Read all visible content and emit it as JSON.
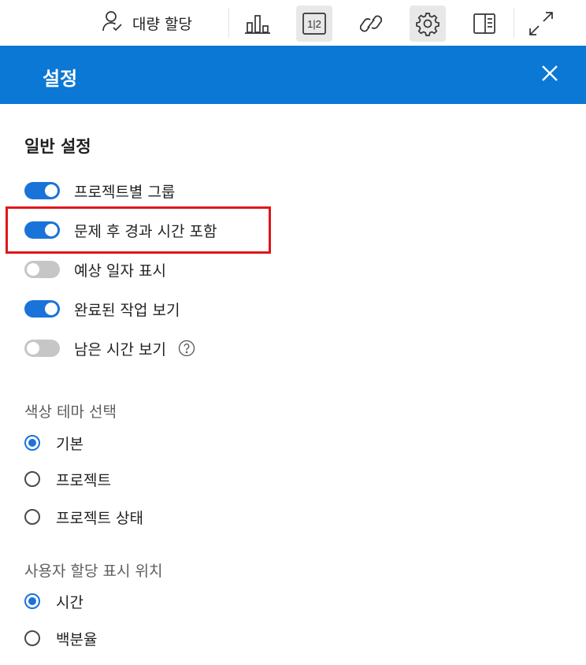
{
  "toolbar": {
    "bulk_assign_label": "대량 할당",
    "bulk_assign_icon": "person-check-icon",
    "chart_icon": "bar-chart-icon",
    "split_view_icon": "one-two-icon",
    "split_view_text": "1|2",
    "link_icon": "link-icon",
    "settings_icon": "gear-icon",
    "panel_icon": "side-panel-icon",
    "expand_icon": "expand-diagonal-icon"
  },
  "panel": {
    "title": "설정",
    "close_icon": "close-icon",
    "accent_color": "#0a78d4"
  },
  "general": {
    "heading": "일반 설정",
    "toggles": [
      {
        "label": "프로젝트별 그룹",
        "on": true
      },
      {
        "label": "문제 후 경과 시간 포함",
        "on": true
      },
      {
        "label": "예상 일자 표시",
        "on": false
      },
      {
        "label": "완료된 작업 보기",
        "on": true
      },
      {
        "label": "남은 시간 보기",
        "on": false
      }
    ],
    "help_icon": "question-circle-icon"
  },
  "color_theme": {
    "heading": "색상 테마 선택",
    "options": [
      {
        "label": "기본",
        "checked": true
      },
      {
        "label": "프로젝트",
        "checked": false
      },
      {
        "label": "프로젝트 상태",
        "checked": false
      }
    ]
  },
  "assignment_display": {
    "heading": "사용자 할당 표시 위치",
    "options": [
      {
        "label": "시간",
        "checked": true
      },
      {
        "label": "백분율",
        "checked": false
      }
    ]
  },
  "highlight_color": "#e0161b"
}
